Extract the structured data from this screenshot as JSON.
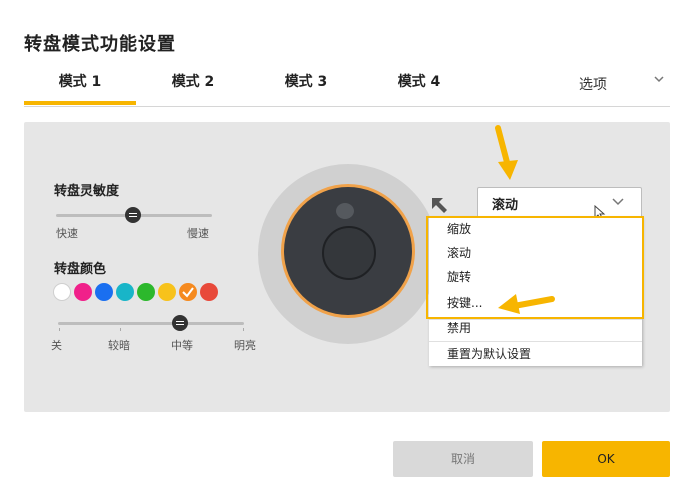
{
  "window": {
    "title": "转盘模式功能设置"
  },
  "tabs": [
    {
      "label": "模式 1",
      "active": true
    },
    {
      "label": "模式 2",
      "active": false
    },
    {
      "label": "模式 3",
      "active": false
    },
    {
      "label": "模式 4",
      "active": false
    }
  ],
  "options": {
    "label": "选项",
    "icon": "chevron-down-icon"
  },
  "sensitivity": {
    "label": "转盘灵敏度",
    "min_label": "快速",
    "max_label": "慢速",
    "level": 0.5
  },
  "color": {
    "label": "转盘颜色",
    "swatches": [
      {
        "hex": "#ffffff",
        "selected": false
      },
      {
        "hex": "#f0208a",
        "selected": false
      },
      {
        "hex": "#1a6ff0",
        "selected": false
      },
      {
        "hex": "#18b5c8",
        "selected": false
      },
      {
        "hex": "#2cb82c",
        "selected": false
      },
      {
        "hex": "#f7c21b",
        "selected": false
      },
      {
        "hex": "#f58a1f",
        "selected": true
      },
      {
        "hex": "#e8493a",
        "selected": false
      }
    ]
  },
  "brightness": {
    "level_index": 2,
    "labels": [
      "关",
      "较暗",
      "中等",
      "明亮"
    ]
  },
  "dial": {
    "accent_hex": "#f0a24a"
  },
  "function_dropdown": {
    "selected": "滚动",
    "items": [
      "缩放",
      "滚动",
      "旋转",
      "按键...",
      "禁用",
      "重置为默认设置"
    ]
  },
  "footer": {
    "cancel_label": "取消",
    "ok_label": "OK"
  },
  "colors": {
    "accent": "#f7b500",
    "panel_bg": "#e6e6e6"
  }
}
